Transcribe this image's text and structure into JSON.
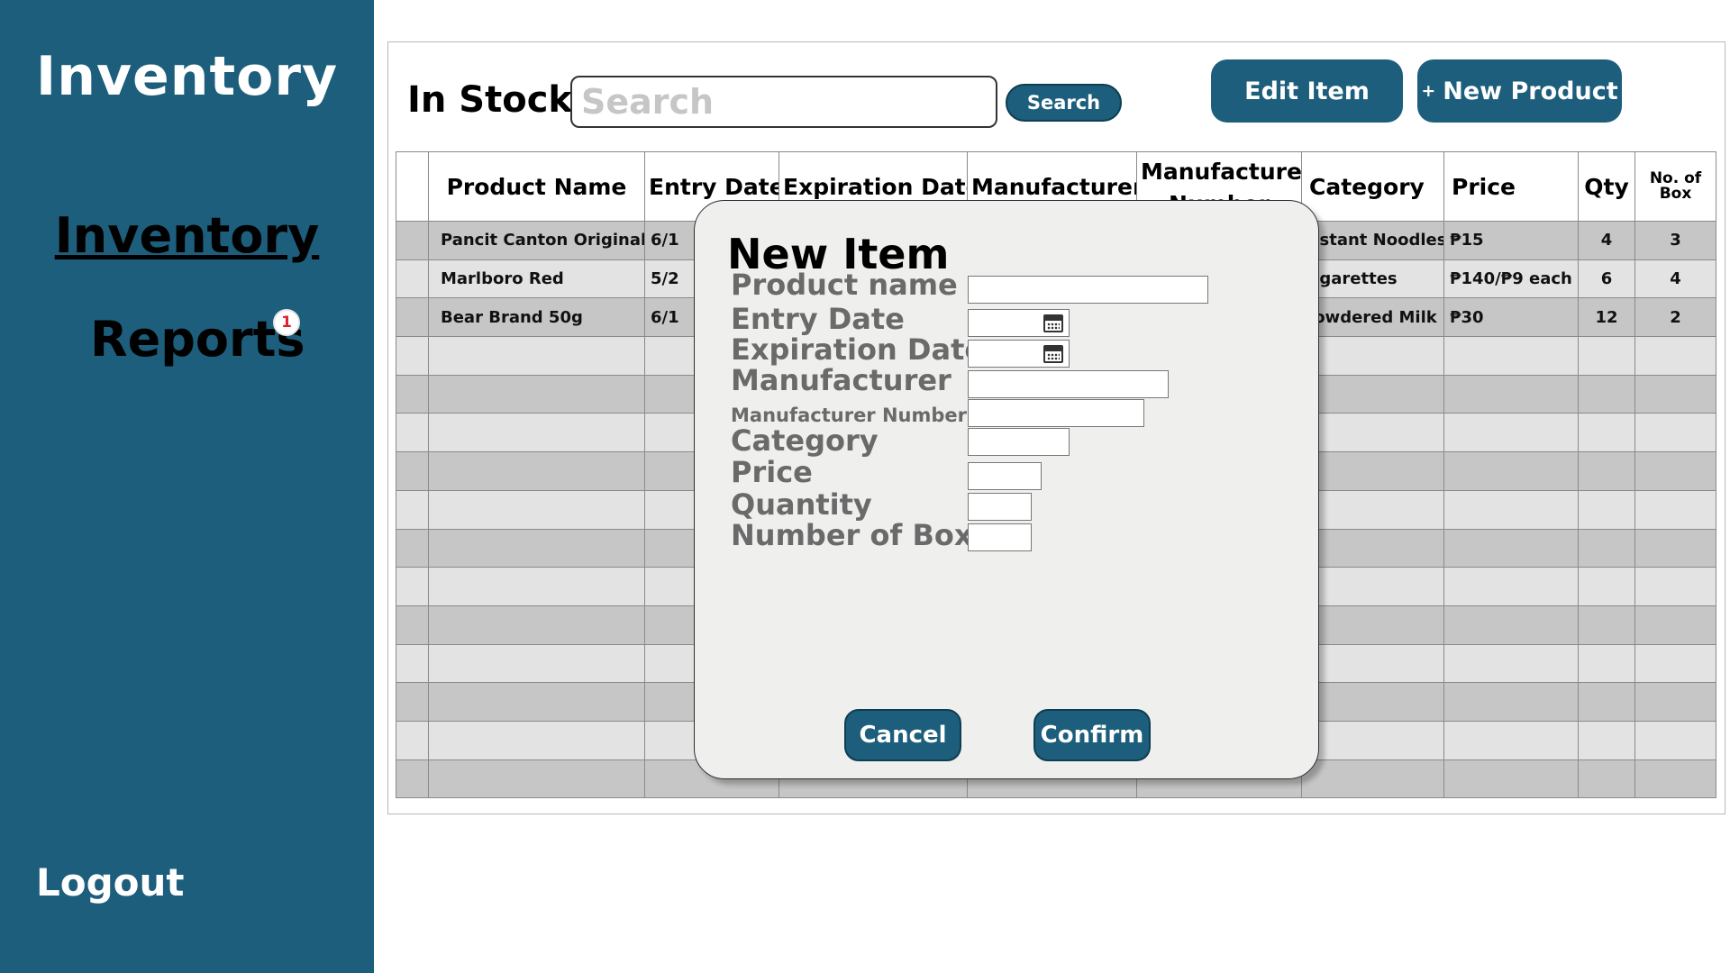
{
  "sidebar": {
    "app_title": "Inventory",
    "nav": {
      "inventory": "Inventory",
      "reports": "Reports",
      "reports_badge": "1"
    },
    "logout": "Logout",
    "bg_color": "#1c5e7b"
  },
  "header": {
    "title": "In Stock",
    "search_placeholder": "Search",
    "search_button": "Search",
    "edit_item_button": "Edit Item",
    "new_product_plus": "+",
    "new_product_button": "New Product"
  },
  "table": {
    "columns": [
      "",
      "Product Name",
      "Entry Date",
      "Expiration Date",
      "Manufacturer",
      "Manufacturer Number",
      "Category",
      "Price",
      "Qty",
      "No. of Box"
    ],
    "rows": [
      {
        "name": "Pancit Canton Original",
        "entry": "6/1",
        "expiry": "",
        "manufacturer": "",
        "mfr_no": "",
        "category": "Instant Noodles",
        "price": "₱15",
        "qty": "4",
        "boxes": "3"
      },
      {
        "name": "Marlboro Red",
        "entry": "5/2",
        "expiry": "",
        "manufacturer": "",
        "mfr_no": "",
        "category": "Cigarettes",
        "price": "₱140/₱9 each",
        "qty": "6",
        "boxes": "4"
      },
      {
        "name": "Bear Brand 50g",
        "entry": "6/1",
        "expiry": "",
        "manufacturer": "",
        "mfr_no": "",
        "category": "Powdered Milk",
        "price": "₱30",
        "qty": "12",
        "boxes": "2"
      }
    ],
    "empty_rows": 12
  },
  "modal": {
    "title": "New Item",
    "fields": {
      "product_name": "Product name",
      "entry_date": "Entry Date",
      "expiration_date": "Expiration Date",
      "manufacturer": "Manufacturer",
      "manufacturer_number": "Manufacturer Number",
      "category": "Category",
      "price": "Price",
      "quantity": "Quantity",
      "number_of_box": "Number of Box"
    },
    "cancel_button": "Cancel",
    "confirm_button": "Confirm"
  }
}
